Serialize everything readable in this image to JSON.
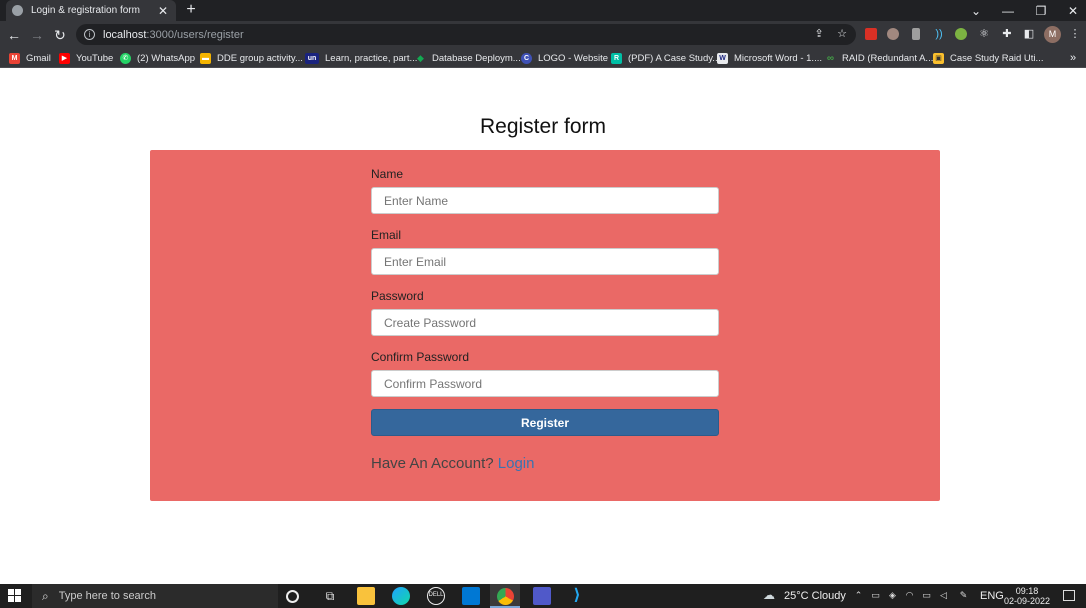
{
  "browser": {
    "tab_title": "Login & registration form",
    "url_host": "localhost",
    "url_path": ":3000/users/register",
    "avatar_letter": "M",
    "bookmarks": [
      {
        "label": "Gmail",
        "color": "#ea4335",
        "glyph": "M"
      },
      {
        "label": "YouTube",
        "color": "#ff0000",
        "glyph": "▶"
      },
      {
        "label": "(2) WhatsApp",
        "color": "#25d366",
        "glyph": "✆"
      },
      {
        "label": "DDE group activity...",
        "color": "#f4b400",
        "glyph": "▬"
      },
      {
        "label": "Learn, practice, part...",
        "color": "#1a237e",
        "glyph": "un"
      },
      {
        "label": "Database Deploym...",
        "color": "#13aa52",
        "glyph": "◆"
      },
      {
        "label": "LOGO - Website",
        "color": "#3f51b5",
        "glyph": "C"
      },
      {
        "label": "(PDF) A Case Study...",
        "color": "#00bfa5",
        "glyph": "R"
      },
      {
        "label": "Microsoft Word - 1....",
        "color": "#e8eaed",
        "glyph": "W"
      },
      {
        "label": "RAID (Redundant A...",
        "color": "#2e7d32",
        "glyph": "∞"
      },
      {
        "label": "Case Study Raid Uti...",
        "color": "#fbc02d",
        "glyph": "▣"
      }
    ],
    "overflow": "»"
  },
  "page": {
    "title": "Register form",
    "fields": [
      {
        "label": "Name",
        "placeholder": "Enter Name",
        "value": ""
      },
      {
        "label": "Email",
        "placeholder": "Enter Email",
        "value": ""
      },
      {
        "label": "Password",
        "placeholder": "Create Password",
        "value": ""
      },
      {
        "label": "Confirm Password",
        "placeholder": "Confirm Password",
        "value": ""
      }
    ],
    "register_label": "Register",
    "have_account_text": "Have An Account?",
    "login_link": "Login",
    "card_color": "#ea6966",
    "button_color": "#35679c",
    "link_color": "#3a73b0"
  },
  "taskbar": {
    "search_placeholder": "Type here to search",
    "weather": "25°C  Cloudy",
    "language": "ENG",
    "time": "09:18",
    "date": "02-09-2022"
  }
}
